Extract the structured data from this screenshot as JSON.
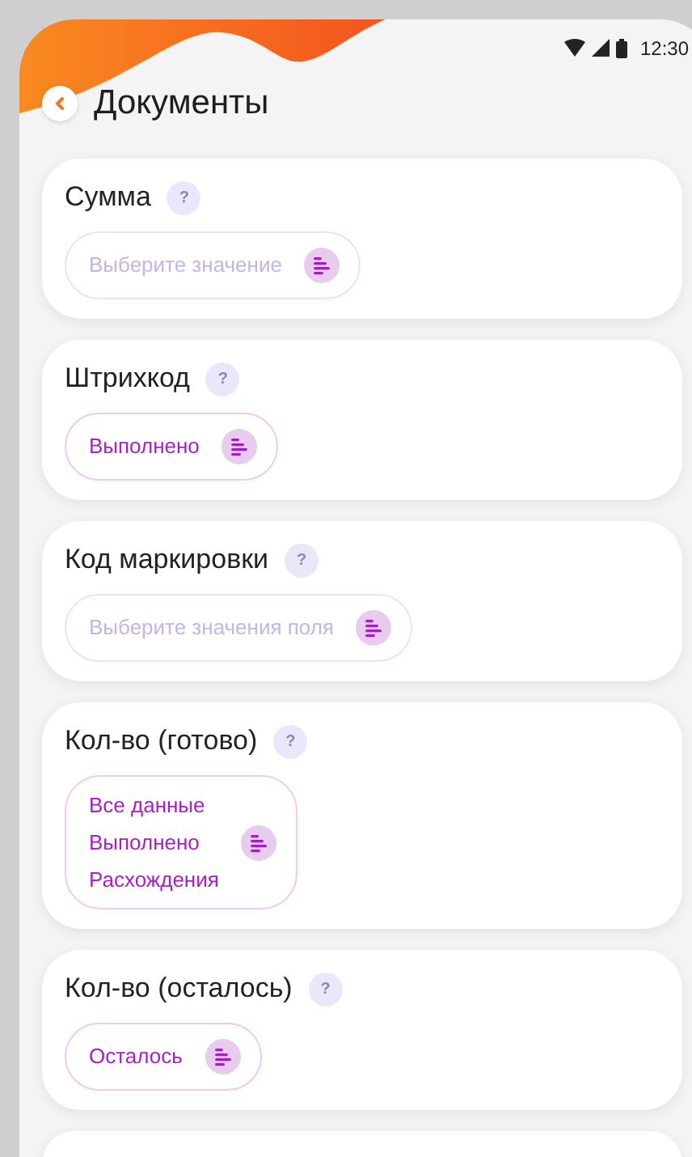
{
  "status_bar": {
    "time": "12:30"
  },
  "header": {
    "title": "Документы"
  },
  "fields": [
    {
      "label": "Сумма",
      "help": "?",
      "placeholder": "Выберите значение"
    },
    {
      "label": "Штрихкод",
      "help": "?",
      "values": [
        "Выполнено"
      ]
    },
    {
      "label": "Код маркировки",
      "help": "?",
      "placeholder": "Выберите значения поля"
    },
    {
      "label": "Кол-во (готово)",
      "help": "?",
      "values": [
        "Все данные",
        "Выполнено",
        "Расхождения"
      ]
    },
    {
      "label": "Кол-во (осталось)",
      "help": "?",
      "values": [
        "Осталось"
      ]
    }
  ]
}
